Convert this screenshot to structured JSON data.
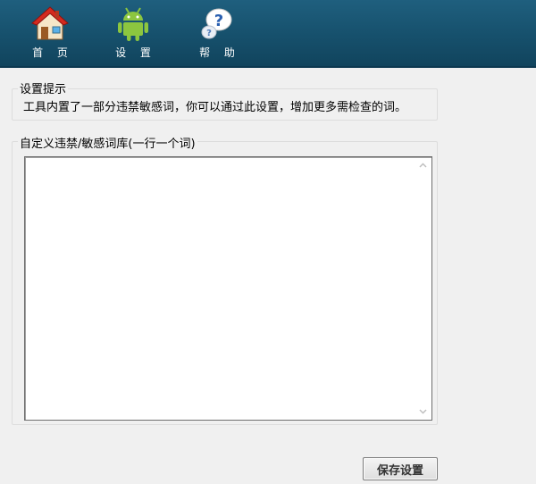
{
  "toolbar": {
    "items": [
      {
        "label": "首 页",
        "icon": "house-icon"
      },
      {
        "label": "设 置",
        "icon": "android-robot-icon"
      },
      {
        "label": "帮 助",
        "icon": "help-question-icon"
      }
    ]
  },
  "hint_group": {
    "title": "设置提示",
    "text": "工具内置了一部分违禁敏感词，你可以通过此设置，增加更多需检查的词。"
  },
  "words_group": {
    "title": "自定义违禁/敏感词库(一行一个词)",
    "value": ""
  },
  "save_button": {
    "label": "保存设置"
  },
  "colors": {
    "toolbar_bg": "#16506c",
    "window_bg": "#f0f0f0",
    "android_green": "#8cc63f"
  }
}
